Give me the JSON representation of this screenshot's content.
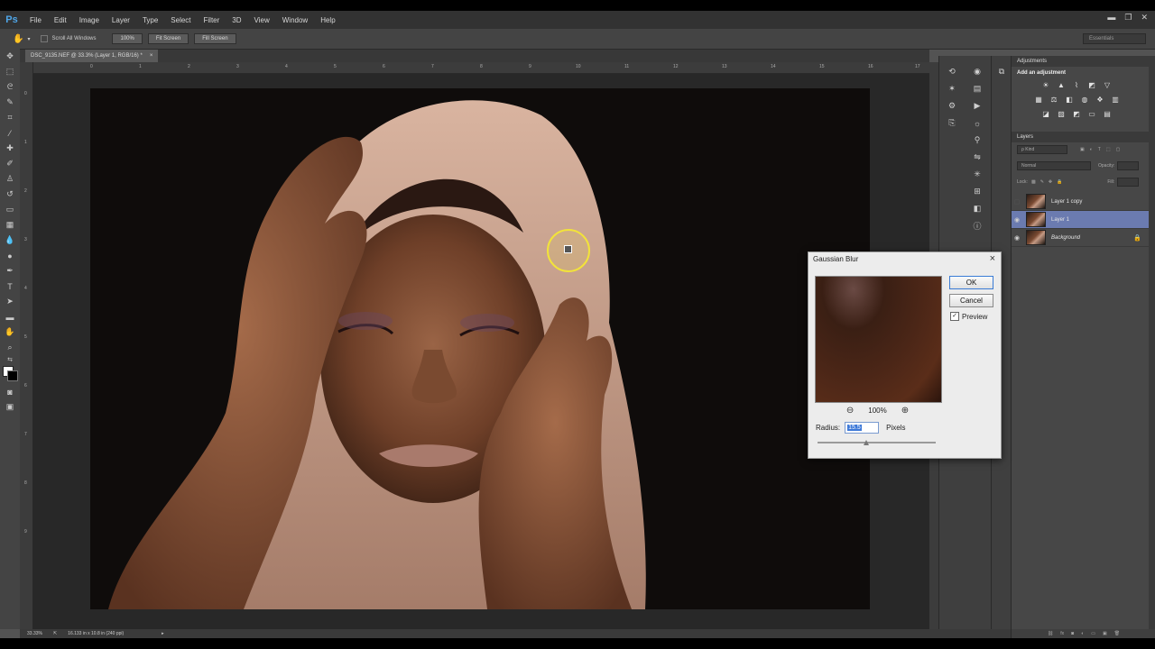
{
  "app": {
    "logo": "Ps"
  },
  "menu": [
    "File",
    "Edit",
    "Image",
    "Layer",
    "Type",
    "Select",
    "Filter",
    "3D",
    "View",
    "Window",
    "Help"
  ],
  "options_bar": {
    "scroll_all_windows": "Scroll All Windows",
    "btn_100": "100%",
    "fit_screen": "Fit Screen",
    "fill_screen": "Fill Screen",
    "workspace": "Essentials"
  },
  "document": {
    "tab_title": "DSC_9135.NEF @ 33.3% (Layer 1, RGB/16) *",
    "tab_close": "×"
  },
  "rulers": {
    "top": [
      "0",
      "1",
      "2",
      "3",
      "4",
      "5",
      "6",
      "7",
      "8",
      "9",
      "10",
      "11",
      "12",
      "13",
      "14",
      "15",
      "16",
      "17"
    ],
    "left": [
      "0",
      "1",
      "2",
      "3",
      "4",
      "5",
      "6",
      "7",
      "8",
      "9"
    ]
  },
  "status": {
    "zoom": "33.33%",
    "doc_size": "16.133 in x 10.8 in (240 ppi)"
  },
  "adjustments": {
    "tab": "Adjustments",
    "title": "Add an adjustment"
  },
  "layers_panel": {
    "tab": "Layers",
    "kind": "ρ Kind",
    "blend": "Normal",
    "opacity_label": "Opacity:",
    "lock_label": "Lock:",
    "fill_label": "Fill:",
    "layers": [
      {
        "name": "Layer 1 copy",
        "visible": false,
        "selected": false
      },
      {
        "name": "Layer 1",
        "visible": true,
        "selected": true
      },
      {
        "name": "Background",
        "visible": true,
        "selected": false
      }
    ]
  },
  "dialog": {
    "title": "Gaussian Blur",
    "close": "×",
    "ok": "OK",
    "cancel": "Cancel",
    "preview_label": "Preview",
    "preview_checked": "✓",
    "zoom": "100%",
    "radius_label": "Radius:",
    "radius_value": "15.5",
    "radius_unit": "Pixels",
    "radius_slider_fraction": 0.41
  },
  "colors": {
    "ui_bg": "#535353",
    "selected_layer": "#6b7bb0",
    "cursor_highlight": "#f2e33a"
  }
}
